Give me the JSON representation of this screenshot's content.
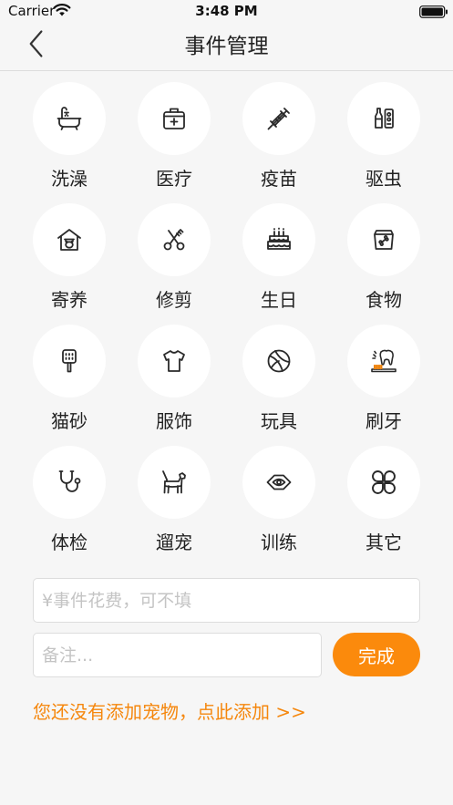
{
  "status_bar": {
    "carrier": "Carrier",
    "time": "3:48 PM"
  },
  "nav": {
    "title": "事件管理"
  },
  "events": [
    {
      "label": "洗澡",
      "icon": "bathtub-icon"
    },
    {
      "label": "医疗",
      "icon": "medical-kit-icon"
    },
    {
      "label": "疫苗",
      "icon": "syringe-icon"
    },
    {
      "label": "驱虫",
      "icon": "deworm-bottle-icon"
    },
    {
      "label": "寄养",
      "icon": "pet-house-icon"
    },
    {
      "label": "修剪",
      "icon": "scissors-icon"
    },
    {
      "label": "生日",
      "icon": "birthday-cake-icon"
    },
    {
      "label": "食物",
      "icon": "food-bag-icon"
    },
    {
      "label": "猫砂",
      "icon": "litter-scoop-icon"
    },
    {
      "label": "服饰",
      "icon": "tshirt-icon"
    },
    {
      "label": "玩具",
      "icon": "ball-icon"
    },
    {
      "label": "刷牙",
      "icon": "toothbrush-icon"
    },
    {
      "label": "体检",
      "icon": "stethoscope-icon"
    },
    {
      "label": "遛宠",
      "icon": "dog-walk-icon"
    },
    {
      "label": "训练",
      "icon": "training-target-icon"
    },
    {
      "label": "其它",
      "icon": "clover-icon"
    }
  ],
  "form": {
    "cost_placeholder": "¥事件花费，可不填",
    "note_placeholder": "备注...",
    "done_label": "完成"
  },
  "footer": {
    "add_pet_text": "您还没有添加宠物，点此添加 >>"
  },
  "colors": {
    "accent": "#fb8a0c",
    "icon_stroke": "#2a2a2a"
  }
}
